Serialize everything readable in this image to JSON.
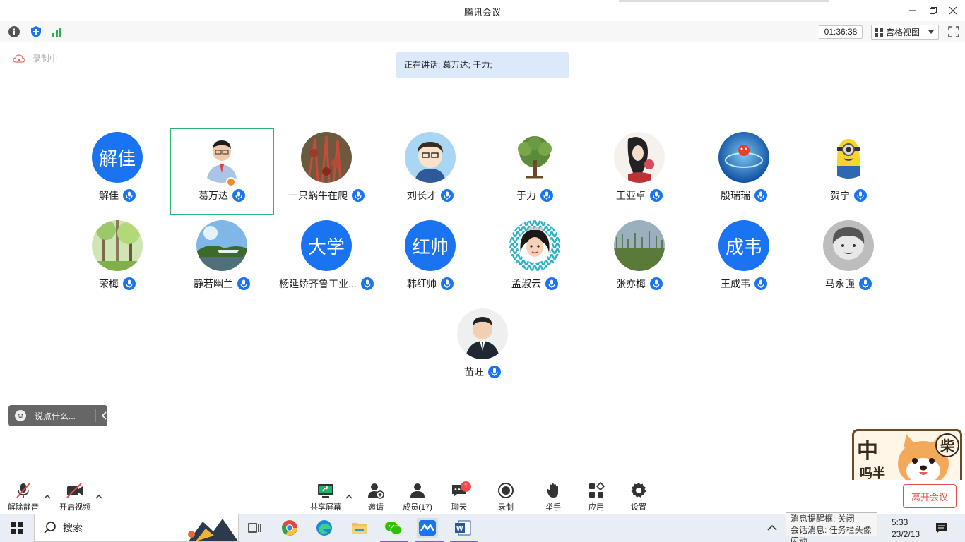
{
  "window": {
    "title": "腾讯会议"
  },
  "status": {
    "timer": "01:36:38",
    "view_mode": "宫格视图"
  },
  "recording": {
    "label": "录制中"
  },
  "speaking": {
    "text": "正在讲话: 葛万达; 于力;"
  },
  "participants": [
    {
      "name": "解佳",
      "avatar_text": "解佳"
    },
    {
      "name": "葛万达",
      "avatar_text": ""
    },
    {
      "name": "一只蜗牛在爬",
      "avatar_text": ""
    },
    {
      "name": "刘长才",
      "avatar_text": ""
    },
    {
      "name": "于力",
      "avatar_text": ""
    },
    {
      "name": "王亚卓",
      "avatar_text": ""
    },
    {
      "name": "殷瑞瑞",
      "avatar_text": ""
    },
    {
      "name": "贺宁",
      "avatar_text": ""
    },
    {
      "name": "荣梅",
      "avatar_text": ""
    },
    {
      "name": "静若幽兰",
      "avatar_text": ""
    },
    {
      "name": "杨延娇齐鲁工业...",
      "avatar_text": "大学"
    },
    {
      "name": "韩红帅",
      "avatar_text": "红帅"
    },
    {
      "name": "孟淑云",
      "avatar_text": ""
    },
    {
      "name": "张亦梅",
      "avatar_text": ""
    },
    {
      "name": "王成韦",
      "avatar_text": "成韦"
    },
    {
      "name": "马永强",
      "avatar_text": ""
    },
    {
      "name": "苗旺",
      "avatar_text": ""
    }
  ],
  "chat": {
    "placeholder": "说点什么..."
  },
  "toolbar": {
    "unmute": "解除静音",
    "video": "开启视频",
    "share": "共享屏幕",
    "invite": "邀请",
    "members": "成员(17)",
    "chat": "聊天",
    "chat_badge": "1",
    "record": "录制",
    "raise_hand": "举手",
    "apps": "应用",
    "settings": "设置",
    "leave": "离开会议"
  },
  "sticker": {
    "text_left": "中",
    "text_left2": "吗半",
    "text_right": "柴"
  },
  "taskbar": {
    "search": "搜索",
    "tray_line1": "消息提醒框: 关闭",
    "tray_line2": "会话消息: 任务栏头像闪动",
    "time": "5:33",
    "date": "23/2/13"
  },
  "colors": {
    "accent": "#1a74f2",
    "active_border": "#2bb673",
    "leave": "#e34d4d",
    "badge": "#f24a4a"
  }
}
